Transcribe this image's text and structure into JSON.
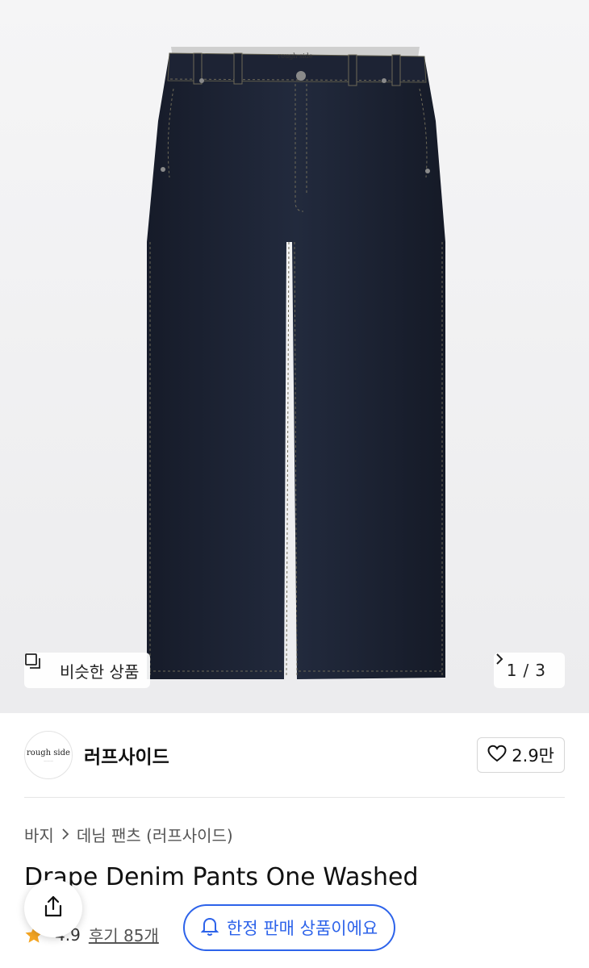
{
  "gallery": {
    "logo_text": "rough side",
    "similar_label": "비슷한 상품",
    "pager": {
      "current": "1",
      "separator": "/",
      "total": "3"
    }
  },
  "brand": {
    "logo_text": "rough side",
    "name": "러프사이드",
    "likes": "2.9만"
  },
  "breadcrumb": {
    "category": "바지",
    "subcategory": "데님 팬츠 (러프사이드)"
  },
  "product": {
    "title": "Drape Denim Pants One Washed",
    "rating": "4.9",
    "reviews": "후기 85개"
  },
  "notice": {
    "limited_label": "한정 판매 상품이에요"
  },
  "colors": {
    "accent": "#2d63ea",
    "star": "#f5a623",
    "denim": "#1c2233"
  },
  "icons": {
    "similar": "overlap-square-icon",
    "pager_next": "chevron-right-icon",
    "like": "heart-outline-icon",
    "share": "share-icon",
    "bell": "bell-icon",
    "star": "star-icon"
  }
}
